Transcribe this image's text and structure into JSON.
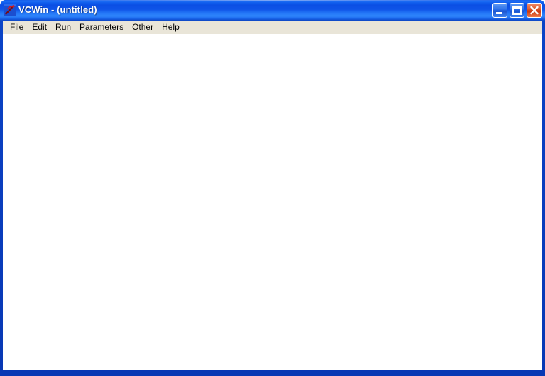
{
  "window": {
    "title": "VCWin - (untitled)",
    "app_icon": "vcwin-curve-icon",
    "frame_color": "#0a3fc0",
    "titlebar_color": "#1056e8",
    "menubar_color": "#e9e5d8",
    "client_color": "#ffffff"
  },
  "caption_buttons": [
    {
      "name": "minimize",
      "label": "Minimize",
      "icon": "minimize-icon",
      "color": "#2a6ee8"
    },
    {
      "name": "maximize",
      "label": "Maximize",
      "icon": "maximize-icon",
      "color": "#2a6ee8"
    },
    {
      "name": "close",
      "label": "Close",
      "icon": "close-icon",
      "color": "#c8360e"
    }
  ],
  "menu": {
    "items": [
      {
        "label": "File"
      },
      {
        "label": "Edit"
      },
      {
        "label": "Run"
      },
      {
        "label": "Parameters"
      },
      {
        "label": "Other"
      },
      {
        "label": "Help"
      }
    ]
  },
  "client": {
    "content": ""
  }
}
